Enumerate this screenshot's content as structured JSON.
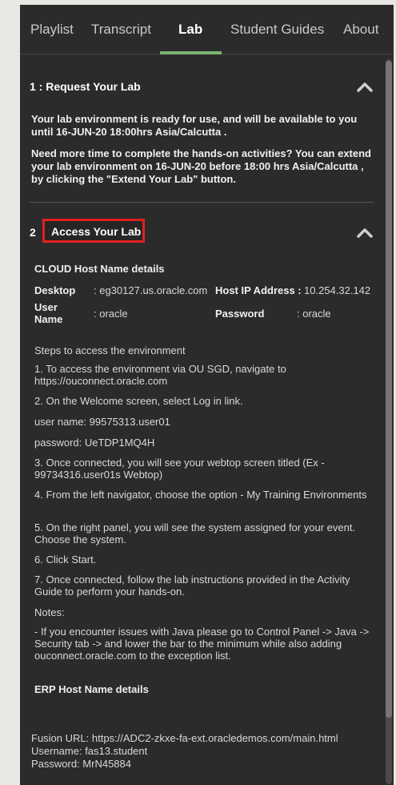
{
  "tabs": [
    {
      "label": "Playlist"
    },
    {
      "label": "Transcript"
    },
    {
      "label": "Lab"
    },
    {
      "label": "Student Guides"
    },
    {
      "label": "About"
    }
  ],
  "section1": {
    "title": "1 : Request Your Lab",
    "para1": "Your lab environment is ready for use, and will be available to you until 16-JUN-20 18:00hrs Asia/Calcutta .",
    "para2": "Need more time to complete the hands-on activities? You can extend your lab environment on 16-JUN-20 before 18:00 hrs Asia/Calcutta , by clicking the \"Extend Your Lab\" button."
  },
  "section2": {
    "number": "2",
    "title": "Access Your Lab",
    "cloud_heading": "CLOUD Host Name details",
    "desktop_label": "Desktop",
    "desktop_value": ": eg30127.us.oracle.com",
    "host_ip_label": "Host IP Address :",
    "host_ip_value": "10.254.32.142",
    "user_label": "User Name",
    "user_value": ": oracle",
    "password_label": "Password",
    "password_value": ": oracle",
    "steps_intro": "Steps to access the environment",
    "step1": "1. To access the environment via OU SGD, navigate to https://ouconnect.oracle.com",
    "step2": "2. On the Welcome screen, select Log in link.",
    "username_line": "user name: 99575313.user01",
    "password_line": "password: UeTDP1MQ4H",
    "step3": "3. Once connected, you will see your webtop screen titled (Ex - 99734316.user01s Webtop)",
    "step4": "4. From the left navigator, choose the option - My Training Environments",
    "step5": "5. On the right panel, you will see the system assigned for your event. Choose the system.",
    "step6": "6. Click Start.",
    "step7": "7. Once connected, follow the lab instructions provided in the Activity Guide to perform your hands-on.",
    "notes_label": "Notes:",
    "note1": "- If you encounter issues with Java please go to Control Panel -> Java -> Security tab -> and lower the bar to the minimum while also adding ouconnect.oracle.com to the exception list.",
    "erp_heading": "ERP Host Name details",
    "fusion_url": "Fusion URL: https://ADC2-zkxe-fa-ext.oracledemos.com/main.html",
    "erp_username": "Username: fas13.student",
    "erp_password": "Password: MrN45884"
  },
  "colors": {
    "panel_bg": "#2b2b2b",
    "active_underline": "#7bb272",
    "highlight_box": "#e0201f"
  }
}
